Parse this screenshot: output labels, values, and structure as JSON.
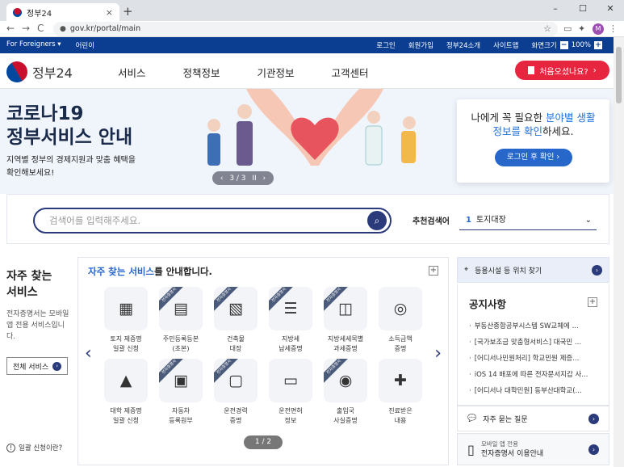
{
  "browser": {
    "tab_title": "정부24",
    "tab_close": "×",
    "new_tab": "+",
    "window_controls": [
      "–",
      "☐",
      "✕"
    ],
    "nav": [
      "←",
      "→",
      "C"
    ],
    "url": "gov.kr/portal/main",
    "profile_initial": "M"
  },
  "utility": {
    "left": [
      "For Foreigners ▾",
      "어린이"
    ],
    "right": [
      "로그인",
      "회원가입",
      "정부24소개",
      "사이트맵"
    ],
    "zoom_label": "화면크기",
    "zoom_value": "100%",
    "zoom_minus": "−",
    "zoom_plus": "+"
  },
  "header": {
    "logo": "정부24",
    "gnb": [
      "서비스",
      "정책정보",
      "기관정보",
      "고객센터"
    ],
    "first_visit": "처음오셨나요?",
    "first_visit_arrow": "›"
  },
  "hero": {
    "title_line1": "코로나19",
    "title_line2": "정부서비스 안내",
    "sub_line1": "지역별 정부의 경제지원과 맞춤 혜택을",
    "sub_line2": "확인해보세요!",
    "pager": {
      "prev": "‹",
      "count": "3 / 3",
      "pause": "II",
      "next": "›"
    }
  },
  "login_card": {
    "msg_pre": "나에게 꼭 필요한 ",
    "msg_em1": "분야별 생활",
    "msg_em2": "정보를 확인",
    "msg_post": "하세요.",
    "button": "로그인 후 확인 ›"
  },
  "search": {
    "placeholder": "검색어를 입력해주세요.",
    "recommend_label": "추천검색어",
    "recommend_rank": "1",
    "recommend_value": "토지대장",
    "chevron": "⌄"
  },
  "left": {
    "title_line1": "자주 찾는",
    "title_line2": "서비스",
    "desc": "전자증명서는 모바일 앱 전용 서비스입니다.",
    "all_services": "전체 서비스",
    "all_services_arrow": "›",
    "apply_help": "일괄 신청이란?",
    "apply_icon": "!"
  },
  "services": {
    "heading_em": "자주 찾는 서비스",
    "heading_rest": "를 안내합니다.",
    "plus": "+",
    "pager": "1 / 2",
    "prev": "‹",
    "next": "›",
    "ribbon": "전자증명서",
    "items": [
      {
        "l1": "토지 제증명",
        "l2": "일괄 신청",
        "icon": "map-icon",
        "sym": "▦",
        "rib": false
      },
      {
        "l1": "주민등록등본",
        "l2": "(초본)",
        "icon": "id-card-icon",
        "sym": "▤",
        "rib": true
      },
      {
        "l1": "건축물",
        "l2": "대장",
        "icon": "receipt-icon",
        "sym": "▧",
        "rib": true
      },
      {
        "l1": "지방세",
        "l2": "납세증명",
        "icon": "document-icon",
        "sym": "☰",
        "rib": true
      },
      {
        "l1": "지방세세목별",
        "l2": "과세증명",
        "icon": "presentation-icon",
        "sym": "◫",
        "rib": true
      },
      {
        "l1": "소득금액",
        "l2": "증명",
        "icon": "coins-icon",
        "sym": "◎",
        "rib": false
      },
      {
        "l1": "대학 제증명",
        "l2": "일괄 신청",
        "icon": "graduation-cap-icon",
        "sym": "▲",
        "rib": false
      },
      {
        "l1": "자동차",
        "l2": "등록원부",
        "icon": "car-icon",
        "sym": "▣",
        "rib": true
      },
      {
        "l1": "운전경력",
        "l2": "증명",
        "icon": "car-front-icon",
        "sym": "▢",
        "rib": true
      },
      {
        "l1": "운전면허",
        "l2": "정보",
        "icon": "license-icon",
        "sym": "▭",
        "rib": false
      },
      {
        "l1": "출입국",
        "l2": "사실증명",
        "icon": "passport-icon",
        "sym": "◉",
        "rib": true
      },
      {
        "l1": "진료받은",
        "l2": "내용",
        "icon": "stethoscope-icon",
        "sym": "✚",
        "rib": false
      }
    ]
  },
  "right": {
    "facility": "등용시설 등 위치 찾기",
    "notice_title": "공지사항",
    "notice_plus": "+",
    "notices": [
      "부동산종합공부시스템 SW교체에 ...",
      "[국가보조금 맞춤형서비스] 대국민 ...",
      "[어디서나민원처리] 학교민원 제증...",
      "iOS 14 배포에 따른 전자문서지갑 사...",
      "[어디서나 대학민원] 동부산대학교(..."
    ],
    "faq": "자주 묻는 질문",
    "mcert_small": "모바일 앱 전용",
    "mcert_big": "전자증명서 이용안내",
    "arrow": "›"
  },
  "colors": {
    "navy": "#0b3d91",
    "accent_red": "#e8253f",
    "blue": "#2667c9"
  }
}
